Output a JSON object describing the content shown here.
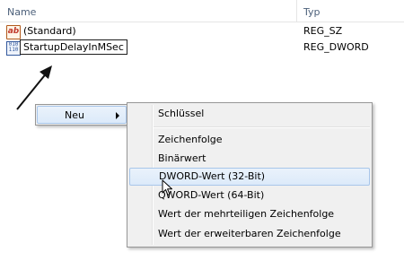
{
  "columns": {
    "name": "Name",
    "type": "Typ"
  },
  "rows": [
    {
      "icon": "string-value-icon",
      "icon_text": "ab",
      "name": "(Standard)",
      "type": "REG_SZ"
    },
    {
      "icon": "binary-value-icon",
      "icon_text": "010\n110",
      "name": "StartupDelayInMSec",
      "type": "REG_DWORD",
      "editing": true
    }
  ],
  "context_menu": {
    "item": "Neu",
    "submenu": {
      "items": [
        "Schlüssel",
        "Zeichenfolge",
        "Binärwert",
        "DWORD-Wert (32-Bit)",
        "QWORD-Wert (64-Bit)",
        "Wert der mehrteiligen Zeichenfolge",
        "Wert der erweiterbaren Zeichenfolge"
      ],
      "highlighted": "DWORD-Wert (32-Bit)"
    }
  }
}
